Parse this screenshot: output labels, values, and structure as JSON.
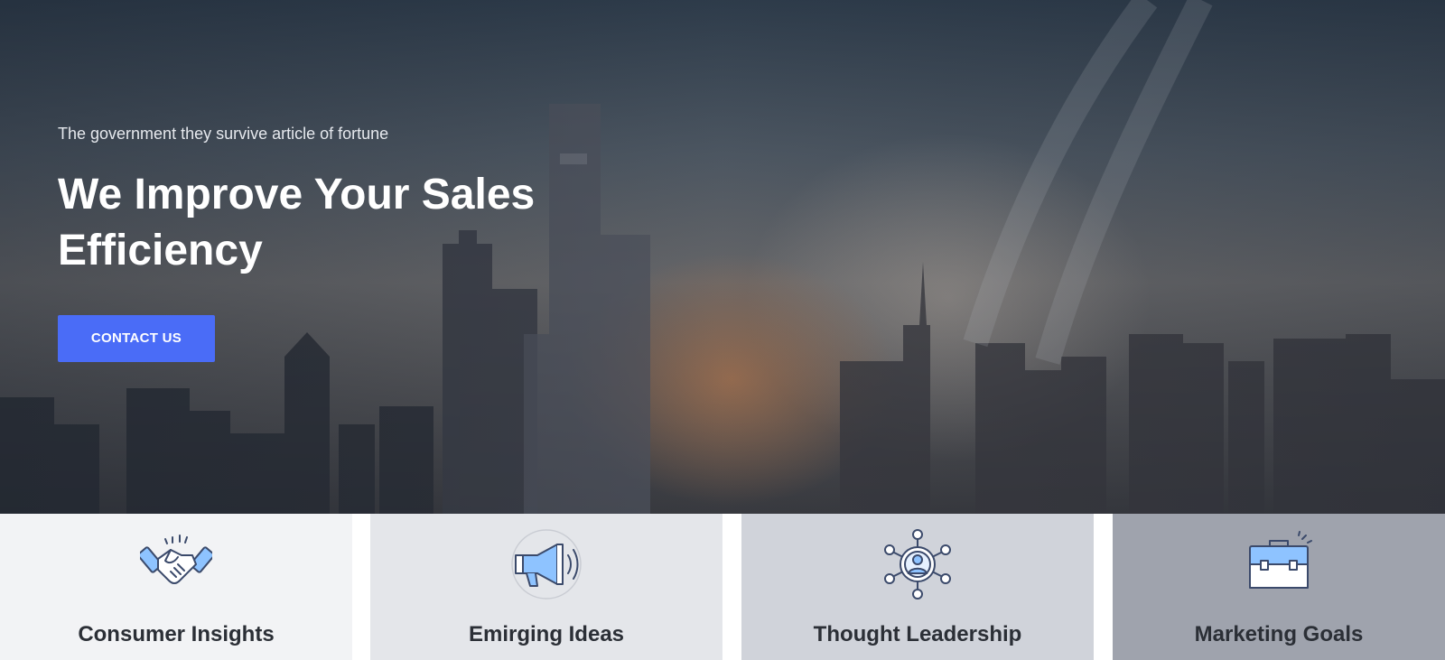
{
  "hero": {
    "tagline": "The government they survive article of fortune",
    "headline": "We Improve Your Sales Efficiency",
    "cta_label": "CONTACT US"
  },
  "features": [
    {
      "title": "Consumer Insights",
      "icon": "handshake-icon",
      "bg": "#f2f3f5"
    },
    {
      "title": "Emirging Ideas",
      "icon": "megaphone-icon",
      "bg": "#e4e6ea"
    },
    {
      "title": "Thought Leadership",
      "icon": "network-user-icon",
      "bg": "#d0d3da"
    },
    {
      "title": "Marketing Goals",
      "icon": "briefcase-icon",
      "bg": "#9fa3ad"
    }
  ],
  "colors": {
    "accent": "#4a6cf7",
    "icon_stroke": "#3b4a6b",
    "icon_fill": "#8ec3ff"
  }
}
